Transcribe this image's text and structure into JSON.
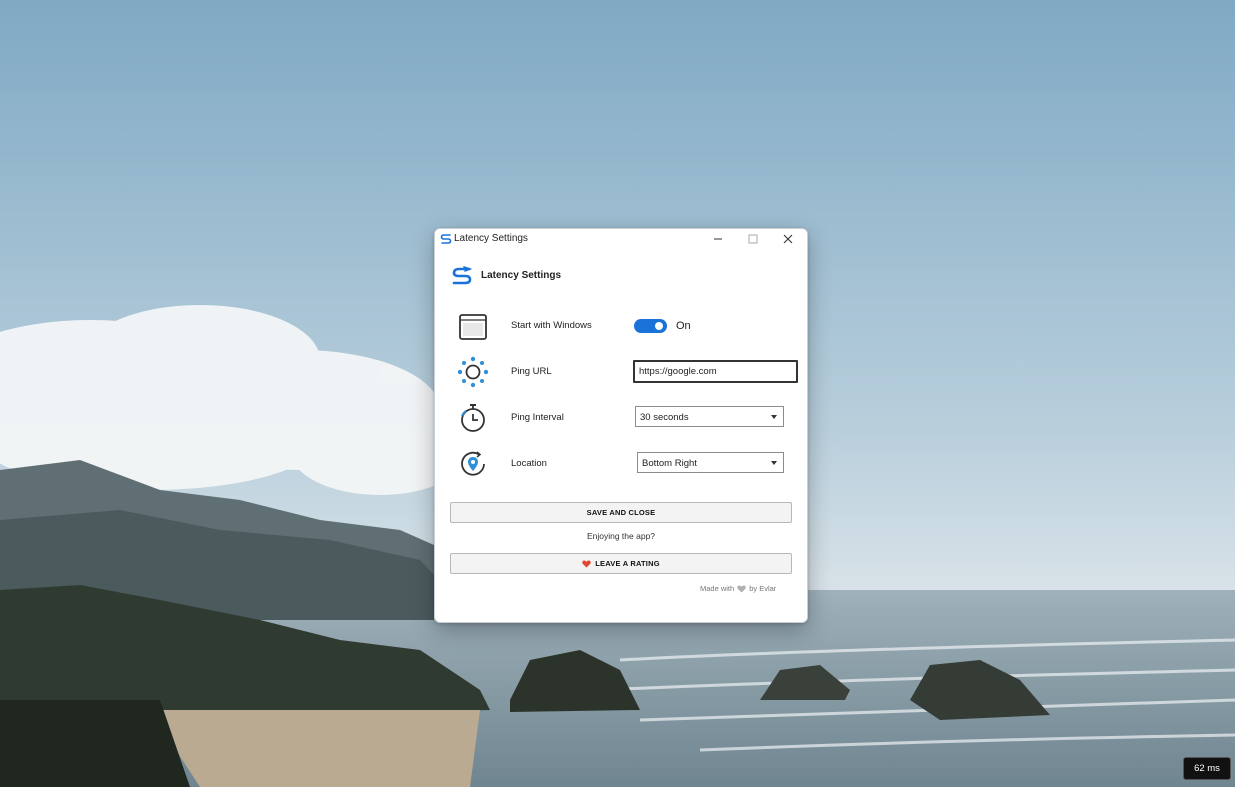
{
  "window": {
    "title": "Latency Settings",
    "heading": "Latency Settings"
  },
  "settings": {
    "start_with_windows": {
      "label": "Start with Windows",
      "toggle_state": "On",
      "enabled": true
    },
    "ping_url": {
      "label": "Ping URL",
      "value": "https://google.com"
    },
    "ping_interval": {
      "label": "Ping Interval",
      "selected": "30 seconds"
    },
    "location": {
      "label": "Location",
      "selected": "Bottom Right"
    }
  },
  "actions": {
    "save_label": "SAVE AND CLOSE",
    "enjoy_text": "Enjoying the app?",
    "rate_label": "LEAVE A RATING"
  },
  "credit": {
    "prefix": "Made with",
    "suffix": "by Evlar"
  },
  "tray": {
    "latency": "62 ms"
  },
  "icons": {
    "app": "latency-app-icon",
    "window_frame": "window-icon",
    "ping_url": "network-gear-icon",
    "interval": "stopwatch-icon",
    "location": "location-pin-icon",
    "heart": "heart-icon"
  },
  "colors": {
    "accent": "#1a73d9",
    "heart": "#e0462f",
    "badge_bg": "#111111"
  }
}
